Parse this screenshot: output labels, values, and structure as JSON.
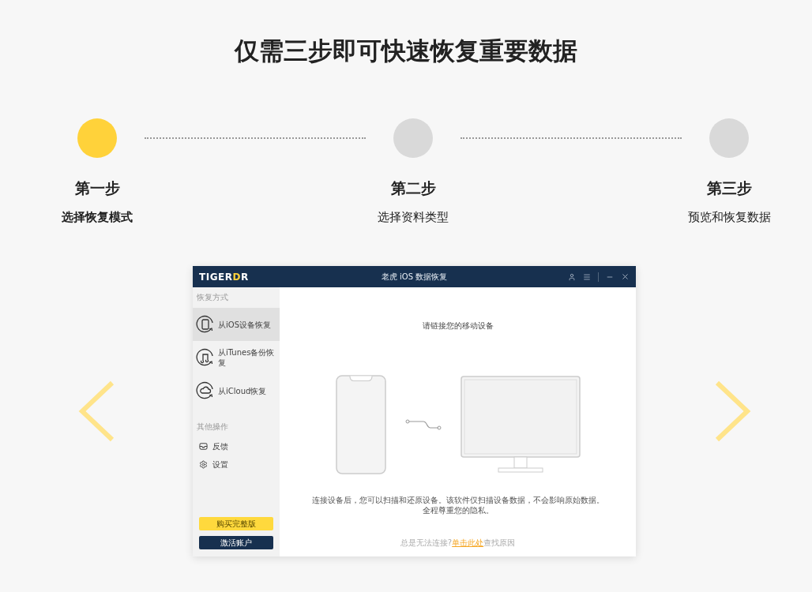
{
  "title": "仅需三步即可快速恢复重要数据",
  "steps": [
    {
      "title": "第一步",
      "subtitle": "选择恢复模式",
      "selected": true
    },
    {
      "title": "第二步",
      "subtitle": "选择资料类型",
      "selected": false
    },
    {
      "title": "第三步",
      "subtitle": "预览和恢复数据",
      "selected": false
    }
  ],
  "app": {
    "logo": {
      "main": "TIGER",
      "accent": "D",
      "tail": "R"
    },
    "window_title": "老虎 iOS 数据恢复",
    "sidebar": {
      "sections": [
        {
          "header": "恢复方式",
          "items": [
            {
              "kind": "phone",
              "label": "从iOS设备恢复",
              "selected": true
            },
            {
              "kind": "music",
              "label": "从iTunes备份恢复",
              "selected": false
            },
            {
              "kind": "cloud",
              "label": "从iCloud恢复",
              "selected": false
            }
          ]
        },
        {
          "header": "其他操作",
          "items": [
            {
              "kind": "feedback",
              "label": "反馈",
              "selected": false
            },
            {
              "kind": "settings",
              "label": "设置",
              "selected": false
            }
          ]
        }
      ],
      "buttons": [
        {
          "kind": "primary",
          "label": "购买完整版"
        },
        {
          "kind": "dark",
          "label": "激活账户"
        }
      ]
    },
    "main": {
      "prompt": "请链接您的移动设备",
      "description": [
        "连接设备后，您可以扫描和还原设备。该软件仅扫描设备数据，不会影响原始数据。",
        "全程尊重您的隐私。"
      ],
      "help": {
        "text": "总是无法连接?",
        "link": "单击此处",
        "tail": "查找原因"
      }
    }
  }
}
